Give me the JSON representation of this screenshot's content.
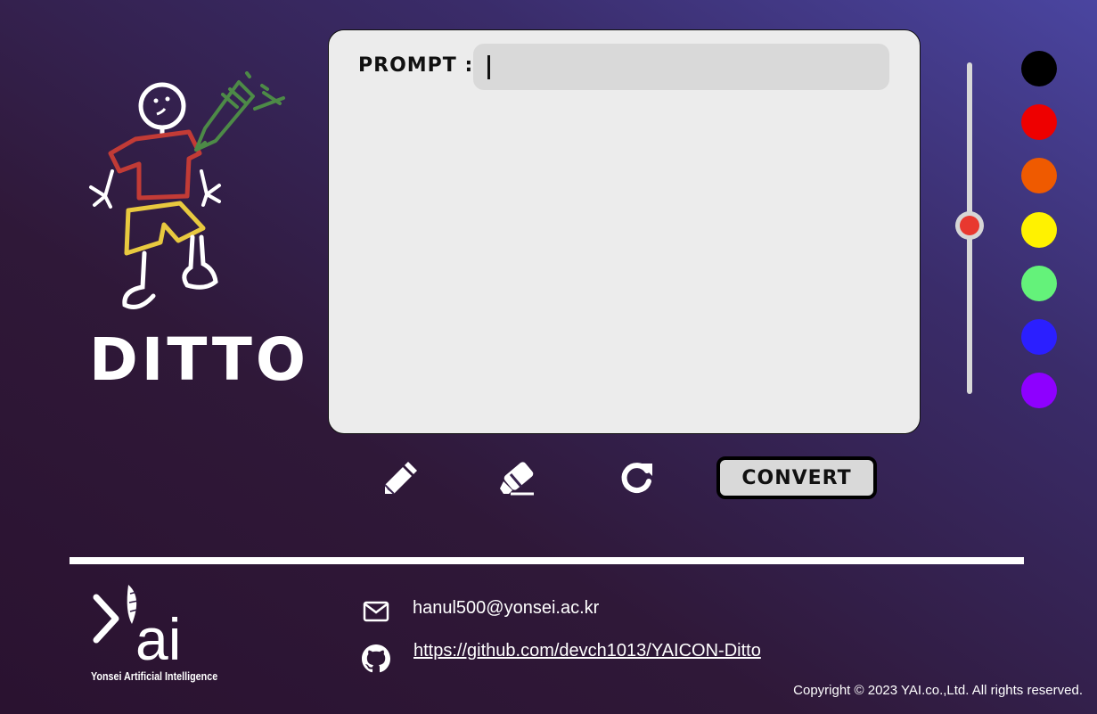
{
  "app": {
    "title": "DITTO"
  },
  "canvas": {
    "prompt_label": "PROMPT :",
    "prompt_value": "",
    "prompt_placeholder": ""
  },
  "brush_size": {
    "level": 0.51
  },
  "palette": {
    "colors": [
      "#000000",
      "#ee0000",
      "#ef5a00",
      "#fff200",
      "#64f27a",
      "#2b1fff",
      "#8e00ff"
    ]
  },
  "tools": {
    "pencil_icon": "pencil-icon",
    "eraser_icon": "eraser-icon",
    "reset_icon": "redo-icon",
    "convert_label": "CONVERT"
  },
  "footer": {
    "logo_text": "ai",
    "tagline": "Yonsei Artificial Intelligence",
    "email": "hanul500@yonsei.ac.kr",
    "github_url": "https://github.com/devch1013/YAICON-Ditto",
    "copyright": "Copyright © 2023 YAI.co.,Ltd. All rights reserved."
  }
}
